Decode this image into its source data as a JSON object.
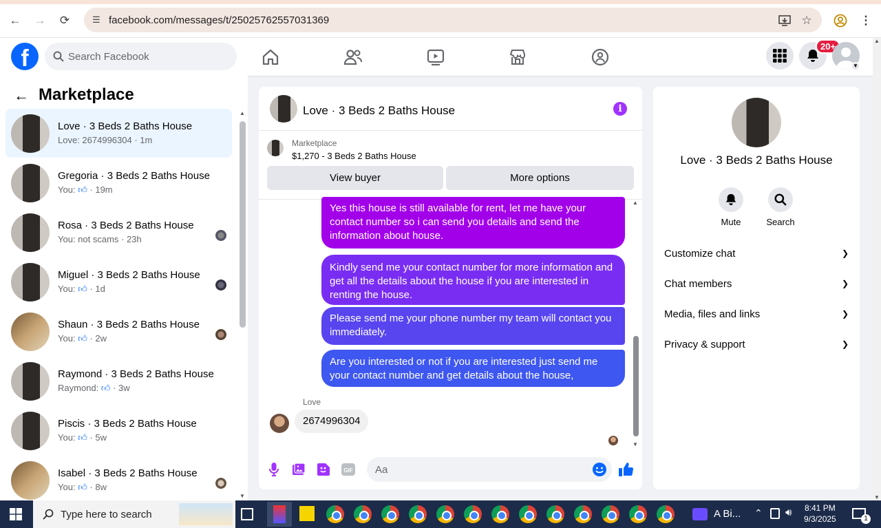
{
  "browser": {
    "url": "facebook.com/messages/t/25025762557031369"
  },
  "header": {
    "search_placeholder": "Search Facebook",
    "notification_count": "20+",
    "logo_letter": "f"
  },
  "sidebar": {
    "title": "Marketplace",
    "conversations": [
      {
        "name": "Love · 3 Beds 2 Baths House",
        "preview": "Love: 2674996304 · 1m",
        "thumb": "a"
      },
      {
        "name": "Gregoria · 3 Beds 2 Baths House",
        "preview_prefix": "You:",
        "preview_suffix": "· 19m",
        "like": true,
        "thumb": "a"
      },
      {
        "name": "Rosa · 3 Beds 2 Baths House",
        "preview": "You: not scams · 23h",
        "thumb": "a"
      },
      {
        "name": "Miguel · 3 Beds 2 Baths House",
        "preview_prefix": "You:",
        "preview_suffix": "· 1d",
        "like": true,
        "thumb": "a"
      },
      {
        "name": "Shaun · 3 Beds 2 Baths House",
        "preview_prefix": "You:",
        "preview_suffix": "· 2w",
        "like": true,
        "thumb": "b"
      },
      {
        "name": "Raymond · 3 Beds 2 Baths House",
        "preview_prefix": "Raymond:",
        "preview_suffix": "· 3w",
        "like": true,
        "thumb": "a"
      },
      {
        "name": "Piscis · 3 Beds 2 Baths House",
        "preview_prefix": "You:",
        "preview_suffix": "· 5w",
        "like": true,
        "thumb": "a"
      },
      {
        "name": "Isabel · 3 Beds 2 Baths House",
        "preview_prefix": "You:",
        "preview_suffix": "· 8w",
        "like": true,
        "thumb": "b"
      }
    ]
  },
  "chat": {
    "title": "Love · 3 Beds 2 Baths House",
    "listing": {
      "label": "Marketplace",
      "price_title": "$1,270 - 3 Beds 2 Baths House",
      "view_buyer": "View buyer",
      "more_options": "More options"
    },
    "outgoing": [
      "Yes this house is still available for rent, let me have your contact number so i can send you details and send the information about house.",
      "Kindly send me your contact number for more information and get all the details about the house if you are interested in renting the house.",
      "Please send me your phone number my team will contact you immediately.",
      "Are you interested or not if you are interested just send me your contact number and get details about the house,"
    ],
    "incoming_sender": "Love",
    "incoming_text": "2674996304",
    "input_placeholder": "Aa"
  },
  "details": {
    "name": "Love · 3 Beds 2 Baths House",
    "mute": "Mute",
    "search": "Search",
    "sections": [
      "Customize chat",
      "Chat members",
      "Media, files and links",
      "Privacy & support"
    ]
  },
  "taskbar": {
    "search_placeholder": "Type here to search",
    "app_label": "A Bi...",
    "time": "8:41 PM",
    "date": "9/3/2025",
    "notif_count": "1"
  },
  "colors": {
    "fb_blue": "#0866ff",
    "messenger_purple": "#a033ff"
  }
}
